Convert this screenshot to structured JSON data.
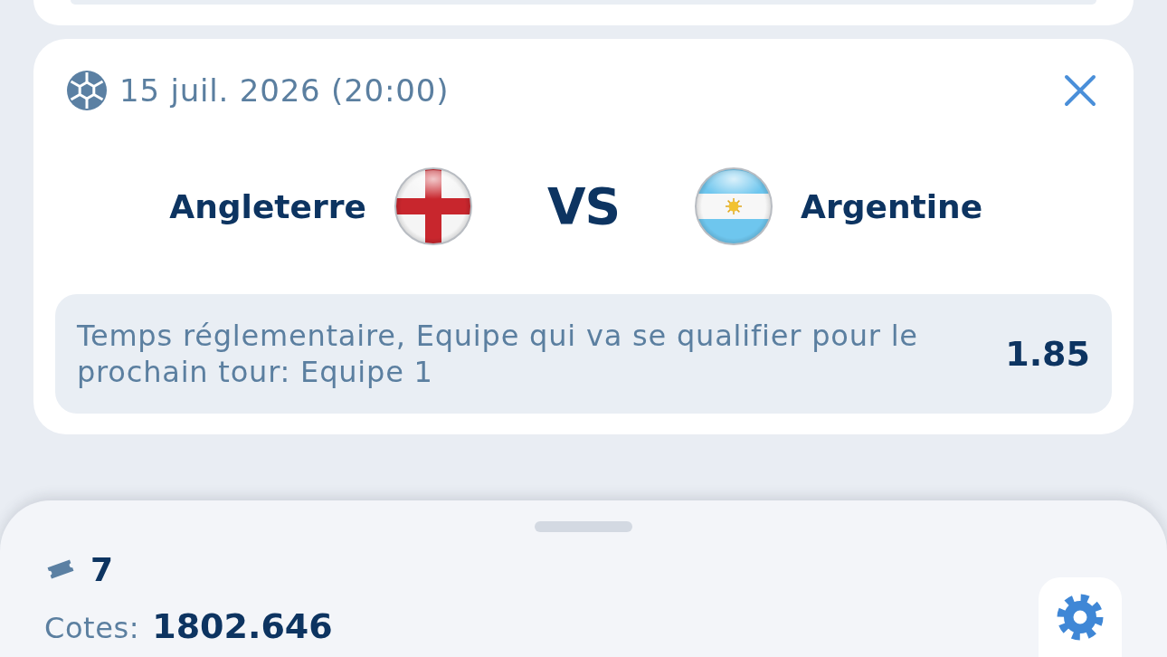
{
  "match": {
    "date": "15 juil. 2026 (20:00)",
    "teams": [
      {
        "name": "Angleterre"
      },
      {
        "name": "Argentine"
      }
    ],
    "vs": "VS",
    "selection": {
      "text": "Temps réglementaire, Equipe qui va se qualifier pour le prochain tour: Equipe 1",
      "odds": "1.85"
    }
  },
  "bet_slip": {
    "count": "7",
    "odds_label": "Cotes:",
    "total_odds": "1802.646"
  }
}
